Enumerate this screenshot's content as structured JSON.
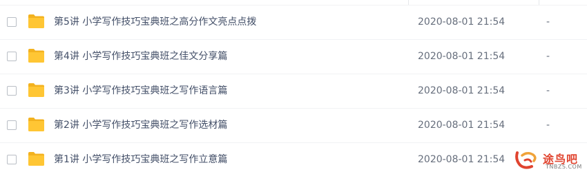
{
  "files": [
    {
      "name": "第5讲 小学写作技巧宝典班之高分作文亮点点拨",
      "date": "2020-08-01 21:54",
      "size": "-"
    },
    {
      "name": "第4讲 小学写作技巧宝典班之佳文分享篇",
      "date": "2020-08-01 21:54",
      "size": "-"
    },
    {
      "name": "第3讲 小学写作技巧宝典班之写作语言篇",
      "date": "2020-08-01 21:54",
      "size": "-"
    },
    {
      "name": "第2讲 小学写作技巧宝典班之写作选材篇",
      "date": "2020-08-01 21:54",
      "size": "-"
    },
    {
      "name": "第1讲 小学写作技巧宝典班之写作立意篇",
      "date": "2020-08-01 21:54",
      "size": ""
    }
  ],
  "watermark": {
    "title": "途鸟吧",
    "subtitle": "TNBZS.COM"
  },
  "colors": {
    "folder": "#ffc634",
    "folder_tab": "#f3b21f",
    "text": "#424e67",
    "meta": "#666e7c",
    "watermark": "#e0442f"
  },
  "icons": {
    "checkbox": "checkbox-icon",
    "folder": "folder-icon",
    "logo": "tnbzs-logo-icon"
  }
}
